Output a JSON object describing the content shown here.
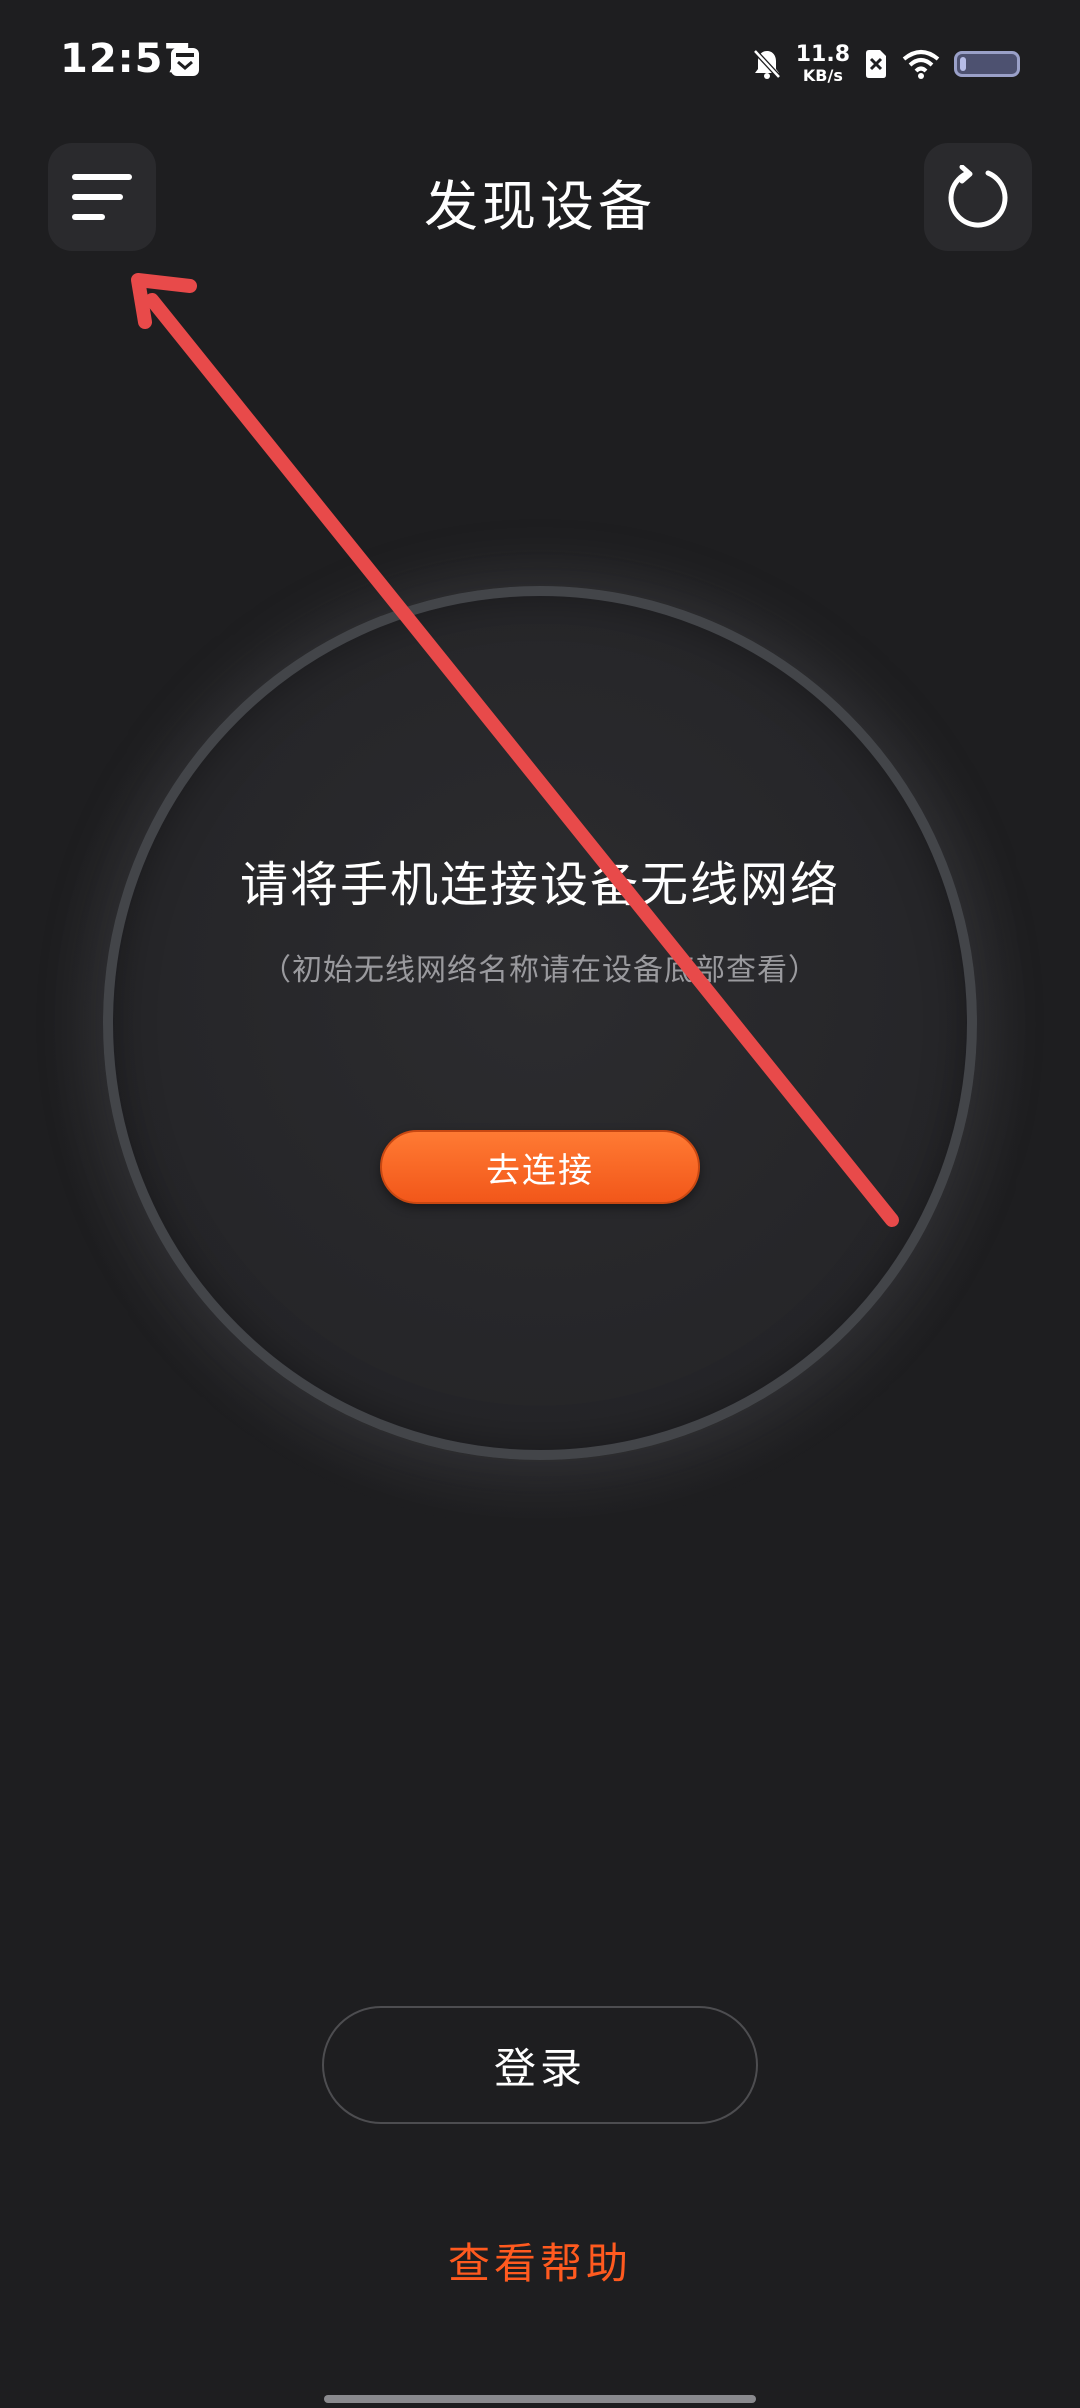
{
  "status_bar": {
    "time": "12:57",
    "net_speed_value": "11.8",
    "net_speed_unit": "KB/s",
    "battery_level": 0.12,
    "icons": [
      "calendar-icon",
      "bell-muted-icon",
      "sim-off-icon",
      "wifi-icon",
      "battery-icon"
    ]
  },
  "header": {
    "title": "发现设备",
    "menu_icon": "menu-icon",
    "refresh_icon": "refresh-icon"
  },
  "panel": {
    "title": "请将手机连接设备无线网络",
    "subtitle": "（初始无线网络名称请在设备底部查看）",
    "connect_label": "去连接"
  },
  "bottom": {
    "login_label": "登录",
    "help_label": "查看帮助"
  },
  "colors": {
    "background": "#1e1e20",
    "accent": "#ff5a1f",
    "annotation": "#e84a4a"
  }
}
